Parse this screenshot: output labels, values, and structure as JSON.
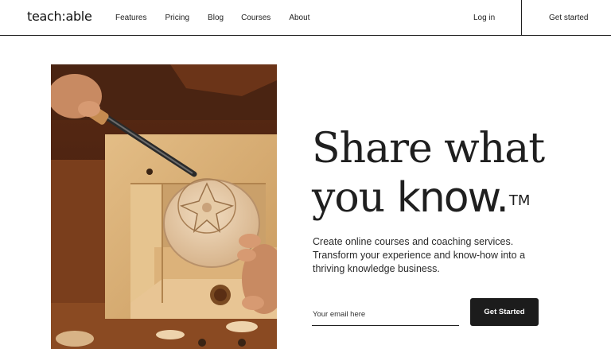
{
  "header": {
    "logo": "teach:able",
    "nav": [
      "Features",
      "Pricing",
      "Blog",
      "Courses",
      "About"
    ],
    "login": "Log in",
    "get_started": "Get started"
  },
  "hero": {
    "image_icon": "woodcarving-photo",
    "headline_line1": "Share what",
    "headline_line2_a": "you ",
    "headline_line2_b": "know.",
    "headline_tm": "TM",
    "subtext": "Create online courses and coaching services. Transform your experience and know-how into a thriving knowledge business.",
    "email_placeholder": "Your email here",
    "email_value": "",
    "cta": "Get Started"
  },
  "colors": {
    "primary": "#1c1c1c",
    "background": "#ffffff",
    "wood_light": "#d9b27c",
    "wood_dark": "#7a3e1c"
  }
}
